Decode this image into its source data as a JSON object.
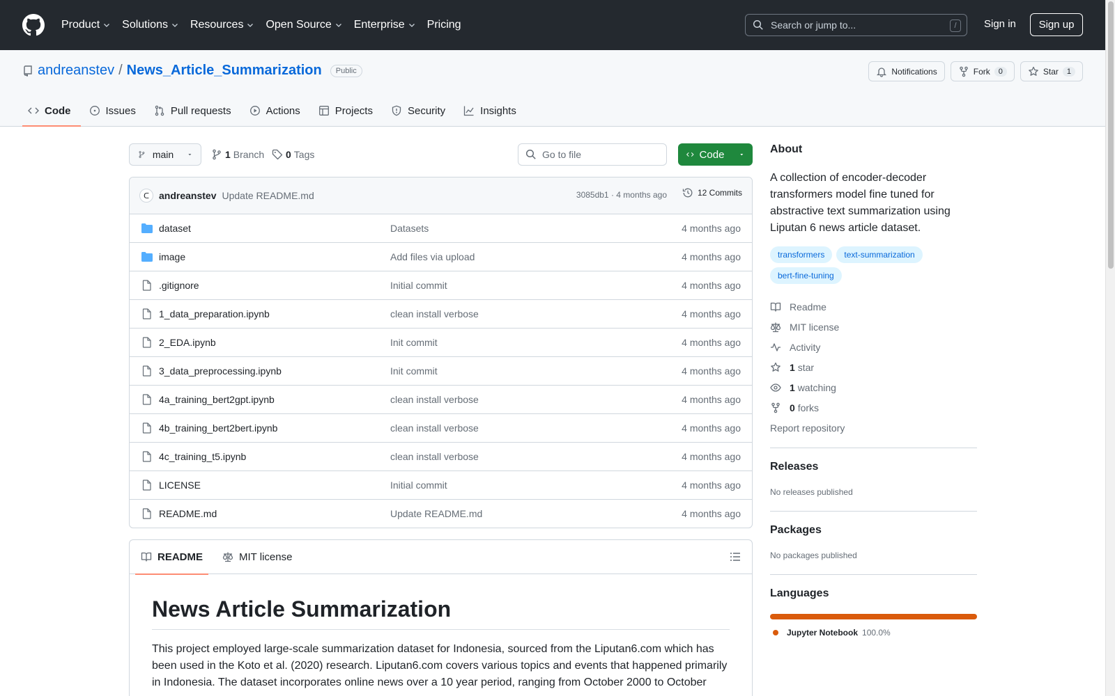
{
  "header": {
    "nav": [
      "Product",
      "Solutions",
      "Resources",
      "Open Source",
      "Enterprise",
      "Pricing"
    ],
    "search_placeholder": "Search or jump to...",
    "search_shortcut": "/",
    "sign_in": "Sign in",
    "sign_up": "Sign up"
  },
  "repo": {
    "owner": "andreanstev",
    "separator": "/",
    "name": "News_Article_Summarization",
    "visibility": "Public",
    "notifications_label": "Notifications",
    "fork_label": "Fork",
    "fork_count": "0",
    "star_label": "Star",
    "star_count": "1",
    "tabs": [
      {
        "label": "Code",
        "icon": "code-icon"
      },
      {
        "label": "Issues",
        "icon": "issue-icon"
      },
      {
        "label": "Pull requests",
        "icon": "pull-request-icon"
      },
      {
        "label": "Actions",
        "icon": "play-icon"
      },
      {
        "label": "Projects",
        "icon": "table-icon"
      },
      {
        "label": "Security",
        "icon": "shield-icon"
      },
      {
        "label": "Insights",
        "icon": "graph-icon"
      }
    ]
  },
  "branch": {
    "name": "main",
    "branch_count": "1",
    "branch_label": "Branch",
    "tag_count": "0",
    "tag_label": "Tags",
    "goto_placeholder": "Go to file",
    "code_button": "Code"
  },
  "commit": {
    "author": "andreanstev",
    "message": "Update README.md",
    "meta": "3085db1 · 4 months ago",
    "count": "12 Commits"
  },
  "files": [
    {
      "name": "dataset",
      "type": "folder",
      "message": "Datasets",
      "time": "4 months ago"
    },
    {
      "name": "image",
      "type": "folder",
      "message": "Add files via upload",
      "time": "4 months ago"
    },
    {
      "name": ".gitignore",
      "type": "file",
      "message": "Initial commit",
      "time": "4 months ago"
    },
    {
      "name": "1_data_preparation.ipynb",
      "type": "file",
      "message": "clean install verbose",
      "time": "4 months ago"
    },
    {
      "name": "2_EDA.ipynb",
      "type": "file",
      "message": "Init commit",
      "time": "4 months ago"
    },
    {
      "name": "3_data_preprocessing.ipynb",
      "type": "file",
      "message": "Init commit",
      "time": "4 months ago"
    },
    {
      "name": "4a_training_bert2gpt.ipynb",
      "type": "file",
      "message": "clean install verbose",
      "time": "4 months ago"
    },
    {
      "name": "4b_training_bert2bert.ipynb",
      "type": "file",
      "message": "clean install verbose",
      "time": "4 months ago"
    },
    {
      "name": "4c_training_t5.ipynb",
      "type": "file",
      "message": "clean install verbose",
      "time": "4 months ago"
    },
    {
      "name": "LICENSE",
      "type": "file",
      "message": "Initial commit",
      "time": "4 months ago"
    },
    {
      "name": "README.md",
      "type": "file",
      "message": "Update README.md",
      "time": "4 months ago"
    }
  ],
  "readme": {
    "tab_readme": "README",
    "tab_license": "MIT license",
    "title": "News Article Summarization",
    "paragraph": "This project employed large-scale summarization dataset for Indonesia, sourced from the Liputan6.com which has been used in the Koto et al. (2020) research. Liputan6.com covers various topics and events that happened primarily in Indonesia. The dataset incorporates online news over a 10 year period, ranging from October 2000 to October"
  },
  "about": {
    "heading": "About",
    "description": "A collection of encoder-decoder transformers model fine tuned for abstractive text summarization using Liputan 6 news article dataset.",
    "topics": [
      "transformers",
      "text-summarization",
      "bert-fine-tuning"
    ],
    "readme": "Readme",
    "license": "MIT license",
    "activity": "Activity",
    "stars_count": "1",
    "stars_label": "star",
    "watching_count": "1",
    "watching_label": "watching",
    "forks_count": "0",
    "forks_label": "forks",
    "report": "Report repository"
  },
  "releases": {
    "heading": "Releases",
    "text": "No releases published"
  },
  "packages": {
    "heading": "Packages",
    "text": "No packages published"
  },
  "languages": {
    "heading": "Languages",
    "name": "Jupyter Notebook",
    "percent": "100.0%",
    "color": "#da5b0b"
  },
  "colors": {
    "header_bg": "#24292f",
    "accent": "#0969da",
    "green": "#1f883d",
    "tab_underline": "#fd8c73"
  }
}
